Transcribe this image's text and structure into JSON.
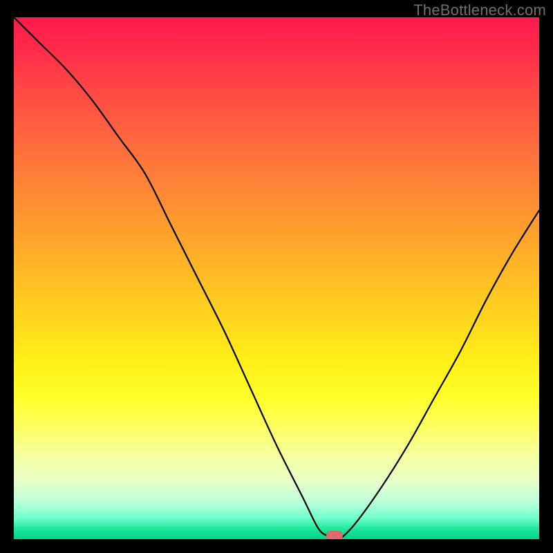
{
  "watermark": "TheBottleneck.com",
  "colors": {
    "frame_bg": "#000000",
    "watermark_text": "#6f6f6f",
    "curve_stroke": "#000000",
    "marker_fill": "#e16a6a"
  },
  "chart_data": {
    "type": "line",
    "title": "",
    "xlabel": "",
    "ylabel": "",
    "xlim": [
      0,
      100
    ],
    "ylim": [
      0,
      100
    ],
    "grid": false,
    "legend": false,
    "annotations": [],
    "series": [
      {
        "name": "bottleneck-curve",
        "x": [
          0,
          5,
          10,
          15,
          20,
          25,
          30,
          35,
          40,
          45,
          50,
          55,
          58,
          60,
          61,
          62,
          65,
          70,
          75,
          80,
          85,
          90,
          95,
          100
        ],
        "values": [
          100,
          95,
          90,
          84,
          77,
          70,
          60,
          50,
          40,
          29,
          18,
          8,
          2,
          0.5,
          0,
          0,
          3,
          10,
          18,
          27,
          36,
          46,
          55,
          63
        ]
      }
    ],
    "marker": {
      "x": 61,
      "y": 0
    },
    "background_gradient_top_to_bottom": [
      "#ff1a4c",
      "#ff4545",
      "#ff8a34",
      "#ffd31e",
      "#ffff2a",
      "#f5ffa0",
      "#b8ffdc",
      "#20e79d",
      "#00d484"
    ]
  }
}
